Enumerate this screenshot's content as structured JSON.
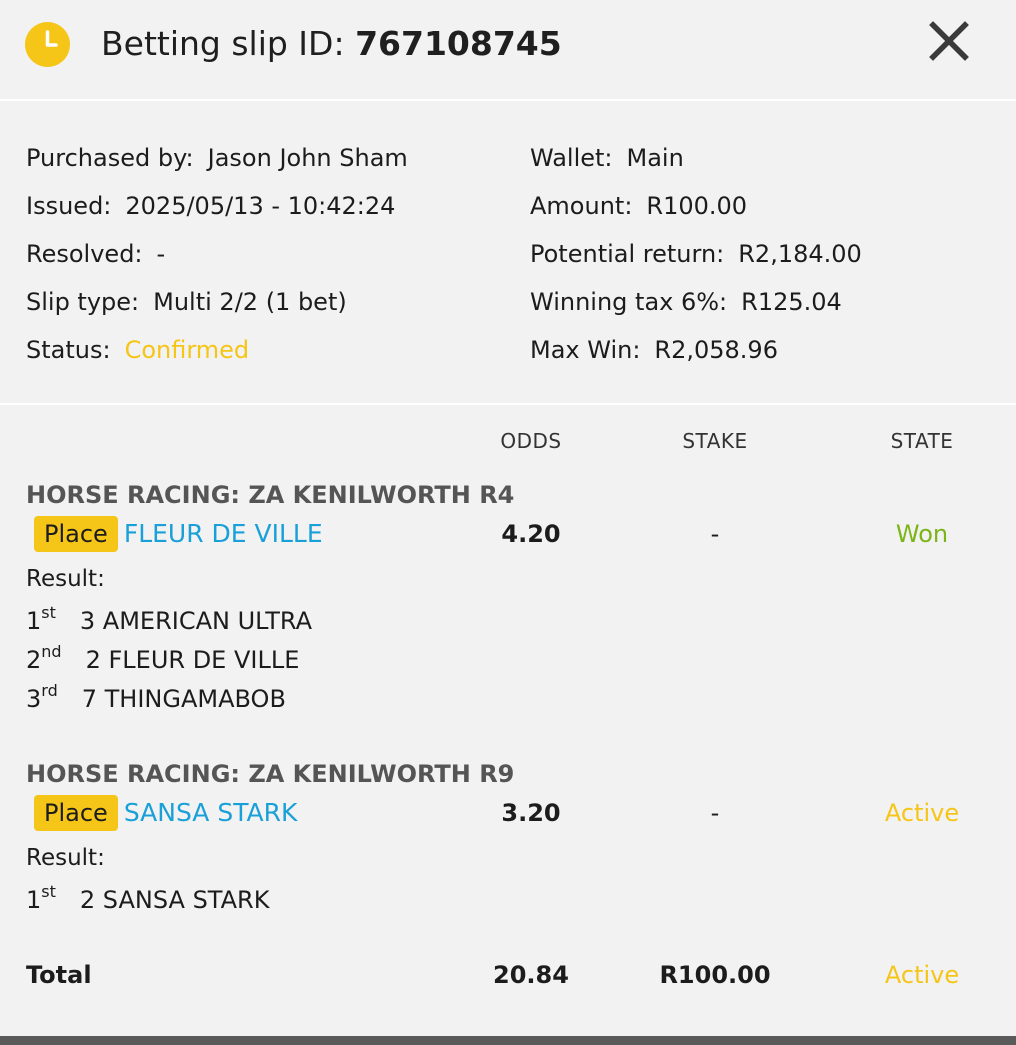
{
  "header": {
    "title_prefix": "Betting slip ID: ",
    "slip_id": "767108745",
    "accent_color": "#f5c518"
  },
  "info": {
    "left": [
      {
        "label": "Purchased by:",
        "value": "Jason John Sham"
      },
      {
        "label": "Issued:",
        "value": "2025/05/13 - 10:42:24"
      },
      {
        "label": "Resolved:",
        "value": "-"
      },
      {
        "label": "Slip type:",
        "value": "Multi 2/2 (1 bet)"
      },
      {
        "label": "Status:",
        "value": "Confirmed"
      }
    ],
    "right": [
      {
        "label": "Wallet:",
        "value": "Main"
      },
      {
        "label": "Amount:",
        "value": "R100.00"
      },
      {
        "label": "Potential return:",
        "value": "R2,184.00"
      },
      {
        "label": "Winning tax 6%:",
        "value": "R125.04"
      },
      {
        "label": "Max Win:",
        "value": "R2,058.96"
      }
    ]
  },
  "columns": {
    "odds": "ODDS",
    "stake": "STAKE",
    "state": "STATE"
  },
  "bets": [
    {
      "event": "HORSE RACING: ZA KENILWORTH R4",
      "market": "Place",
      "selection": "FLEUR DE VILLE",
      "odds": "4.20",
      "stake": "-",
      "state": "Won",
      "result_label": "Result:",
      "results": [
        {
          "pos": "1",
          "suffix": "st",
          "horse": "3 AMERICAN ULTRA"
        },
        {
          "pos": "2",
          "suffix": "nd",
          "horse": "2 FLEUR DE VILLE"
        },
        {
          "pos": "3",
          "suffix": "rd",
          "horse": "7 THINGAMABOB"
        }
      ]
    },
    {
      "event": "HORSE RACING: ZA KENILWORTH R9",
      "market": "Place",
      "selection": "SANSA STARK",
      "odds": "3.20",
      "stake": "-",
      "state": "Active",
      "result_label": "Result:",
      "results": [
        {
          "pos": "1",
          "suffix": "st",
          "horse": "2 SANSA STARK"
        }
      ]
    }
  ],
  "total": {
    "label": "Total",
    "odds": "20.84",
    "stake": "R100.00",
    "state": "Active"
  },
  "colors": {
    "won": "#7cb518",
    "active": "#f5c518",
    "selection": "#1aa0d8"
  },
  "icons": {
    "header": "clock-icon",
    "close": "close-icon"
  }
}
